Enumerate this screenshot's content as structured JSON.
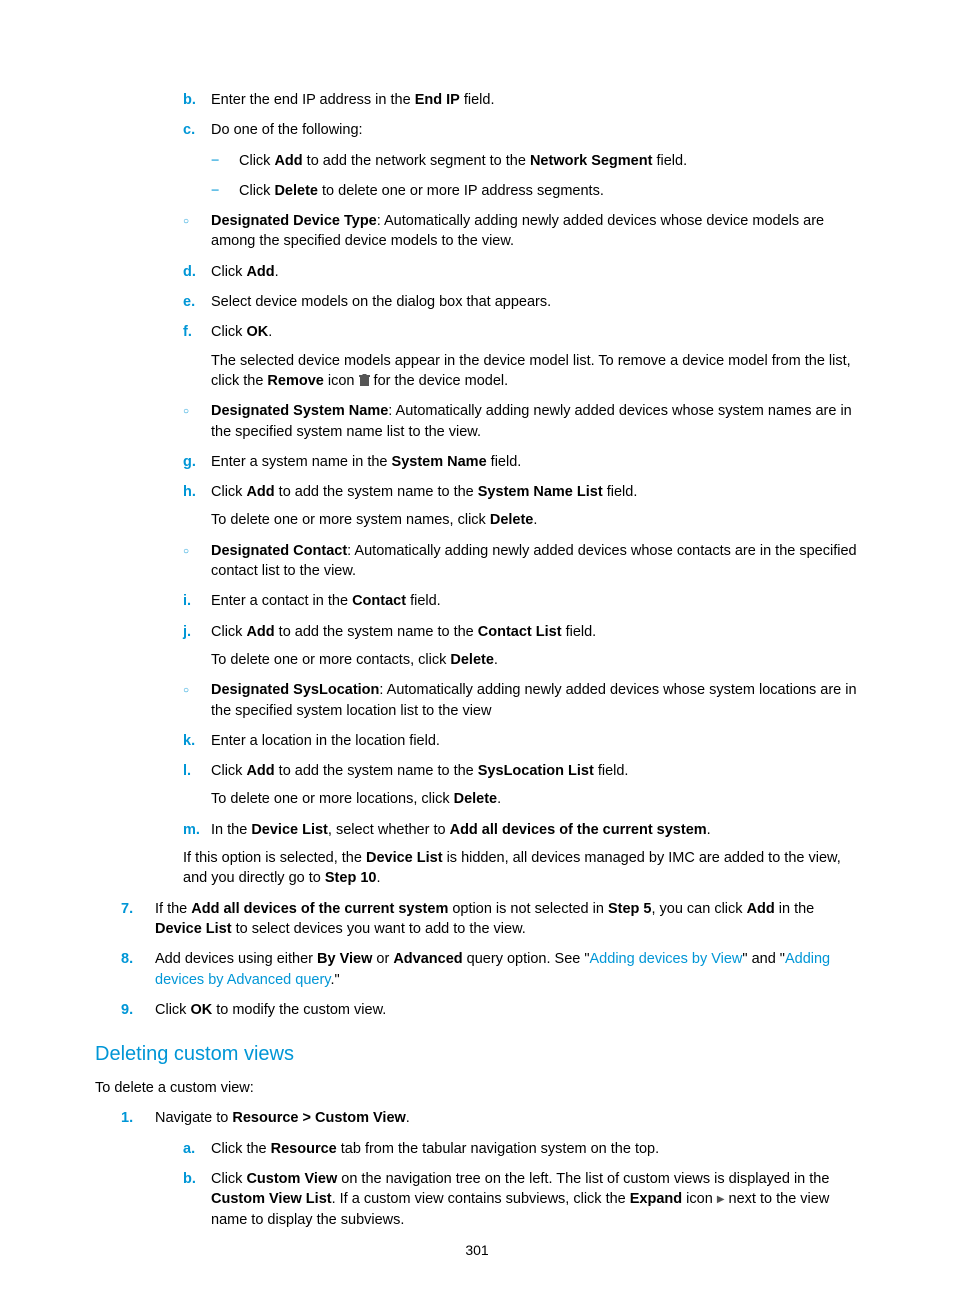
{
  "list1": {
    "b": {
      "m": "b.",
      "t1": "Enter the end IP address in the ",
      "b1": "End IP",
      "t2": " field."
    },
    "c": {
      "m": "c.",
      "t": "Do one of the following:"
    },
    "c_d1": {
      "m": "−",
      "t1": "Click ",
      "b1": "Add",
      "t2": " to add the network segment to the ",
      "b2": "Network Segment",
      "t3": " field."
    },
    "c_d2": {
      "m": "−",
      "t1": "Click ",
      "b1": "Delete",
      "t2": " to delete one or more IP address segments."
    },
    "o1": {
      "m": "○",
      "b1": "Designated Device Type",
      "t": ": Automatically adding newly added devices whose device models are among the specified device models to the view."
    },
    "d": {
      "m": "d.",
      "t1": "Click ",
      "b1": "Add",
      "t2": "."
    },
    "e": {
      "m": "e.",
      "t": "Select device models on the dialog box that appears."
    },
    "f": {
      "m": "f.",
      "t1": "Click ",
      "b1": "OK",
      "t2": ".",
      "cont1": "The selected device models appear in the device model list. To remove a device model from the list, click the ",
      "cont_b": "Remove",
      "cont2": " icon ",
      "cont3": " for the device model."
    },
    "o2": {
      "m": "○",
      "b1": "Designated System Name",
      "t": ": Automatically adding newly added devices whose system names are in the specified system name list to the view."
    },
    "g": {
      "m": "g.",
      "t1": "Enter a system name in the ",
      "b1": "System Name",
      "t2": " field."
    },
    "h": {
      "m": "h.",
      "t1": "Click ",
      "b1": "Add",
      "t2": " to add the system name to the ",
      "b2": "System Name List",
      "t3": " field.",
      "cont1": "To delete one or more system names, click ",
      "cont_b": "Delete",
      "cont2": "."
    },
    "o3": {
      "m": "○",
      "b1": "Designated Contact",
      "t": ": Automatically adding newly added devices whose contacts are in the specified contact list to the view."
    },
    "i": {
      "m": "i.",
      "t1": "Enter a contact in the ",
      "b1": "Contact",
      "t2": " field."
    },
    "j": {
      "m": "j.",
      "t1": "Click ",
      "b1": "Add",
      "t2": " to add the system name to the ",
      "b2": "Contact List",
      "t3": " field.",
      "cont1": "To delete one or more contacts, click ",
      "cont_b": "Delete",
      "cont2": "."
    },
    "o4": {
      "m": "○",
      "b1": "Designated SysLocation",
      "t": ": Automatically adding newly added devices whose system locations are in the specified system location list to the view"
    },
    "k": {
      "m": "k.",
      "t": "Enter a location in the location field."
    },
    "l": {
      "m": "l.",
      "t1": "Click ",
      "b1": "Add",
      "t2": " to add the system name to the ",
      "b2": "SysLocation List",
      "t3": " field.",
      "cont1": "To delete one or more locations, click ",
      "cont_b": "Delete",
      "cont2": "."
    },
    "mrow": {
      "m": "m.",
      "t1": "In the ",
      "b1": "Device List",
      "t2": ", select whether to ",
      "b2": "Add all devices of the current system",
      "t3": "."
    },
    "mnote": {
      "t1": "If this option is selected, the ",
      "b1": "Device List",
      "t2": " is hidden, all devices managed by IMC are added to the view, and you directly go to ",
      "b2": "Step 10",
      "t3": "."
    }
  },
  "step7": {
    "m": "7.",
    "t1": "If the ",
    "b1": "Add all devices of the current system",
    "t2": " option is not selected in ",
    "b2": "Step 5",
    "t3": ", you can click ",
    "b3": "Add",
    "t4": " in the ",
    "b4": "Device List",
    "t5": " to select devices you want to add to the view."
  },
  "step8": {
    "m": "8.",
    "t1": "Add devices using either ",
    "b1": "By View",
    "t2": " or ",
    "b2": "Advanced",
    "t3": " query option. See \"",
    "l1": "Adding devices by View",
    "t4": "\" and \"",
    "l2": "Adding devices by Advanced query",
    "t5": ".\""
  },
  "step9": {
    "m": "9.",
    "t1": "Click ",
    "b1": "OK",
    "t2": " to modify the custom view."
  },
  "section2": {
    "title": "Deleting custom views",
    "intro": "To delete a custom view:",
    "s1": {
      "m": "1.",
      "t1": "Navigate to ",
      "b1": "Resource > Custom View",
      "t2": "."
    },
    "a": {
      "m": "a.",
      "t1": "Click the ",
      "b1": "Resource",
      "t2": " tab from the tabular navigation system on the top."
    },
    "b": {
      "m": "b.",
      "t1": "Click ",
      "b1": "Custom View",
      "t2": " on the navigation tree on the left. The list of custom views is displayed in the ",
      "b2": "Custom View List",
      "t3": ". If a custom view contains subviews, click the ",
      "b3": "Expand",
      "t4": " icon ",
      "t5": " next to the view name to display the subviews."
    }
  },
  "pagenum": "301"
}
